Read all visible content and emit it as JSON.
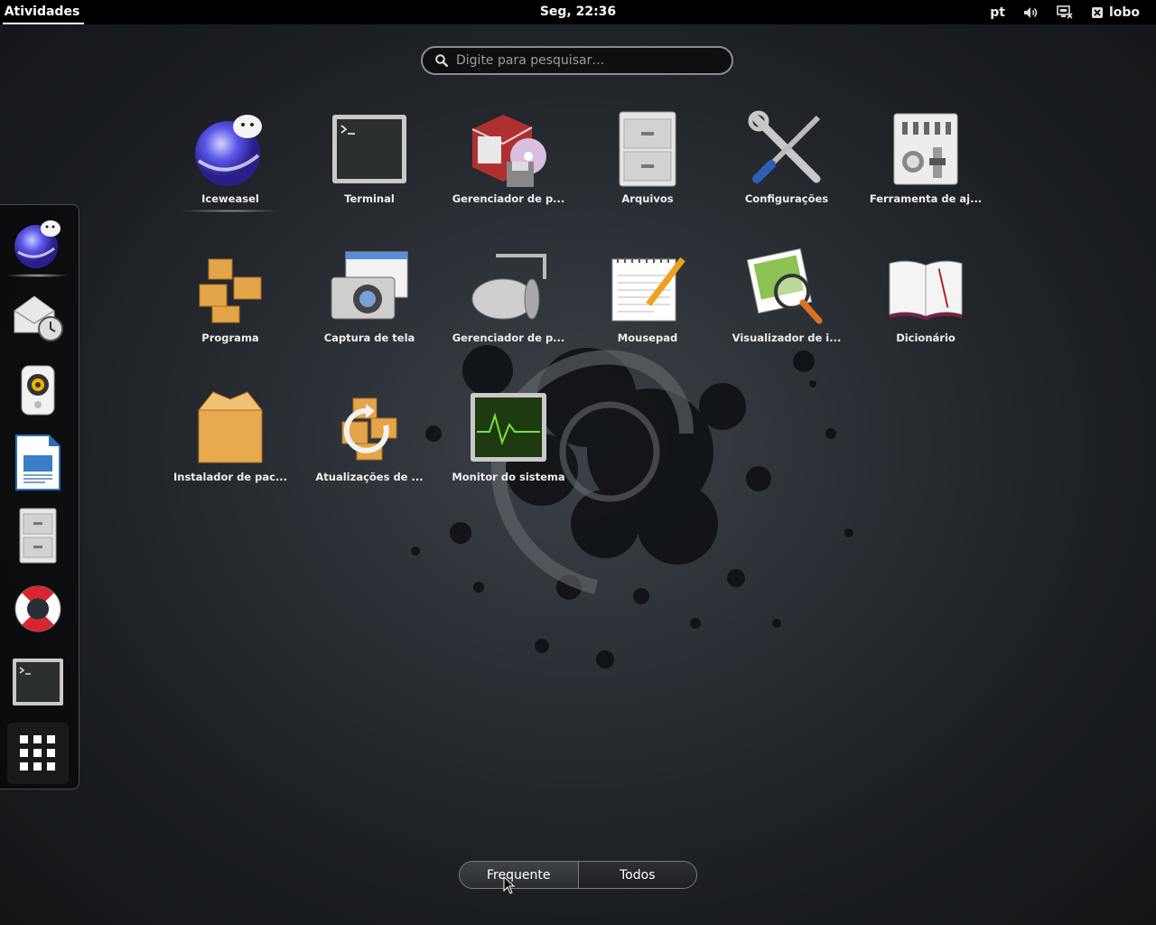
{
  "topbar": {
    "activities": "Atividades",
    "clock": "Seg, 22:36",
    "lang": "pt",
    "user": "lobo"
  },
  "search": {
    "placeholder": "Digite para pesquisar…"
  },
  "dash": {
    "items": [
      "iceweasel-icon",
      "mail-clock-icon",
      "speaker-icon",
      "writer-document-icon",
      "file-cabinet-icon",
      "lifebuoy-icon",
      "terminal-icon",
      "apps-grid-icon"
    ]
  },
  "apps": [
    {
      "label": "Iceweasel",
      "icon": "iceweasel-icon"
    },
    {
      "label": "Terminal",
      "icon": "terminal-icon"
    },
    {
      "label": "Gerenciador de p...",
      "icon": "package-manager-icon"
    },
    {
      "label": "Arquivos",
      "icon": "file-cabinet-icon"
    },
    {
      "label": "Configurações",
      "icon": "tools-icon"
    },
    {
      "label": "Ferramenta de aj...",
      "icon": "mixer-icon"
    },
    {
      "label": "Programa",
      "icon": "boxes-icon"
    },
    {
      "label": "Captura de tela",
      "icon": "camera-icon"
    },
    {
      "label": "Gerenciador de p...",
      "icon": "roller-icon"
    },
    {
      "label": "Mousepad",
      "icon": "notepad-icon"
    },
    {
      "label": "Visualizador de i...",
      "icon": "image-viewer-icon"
    },
    {
      "label": "Dicionário",
      "icon": "book-icon"
    },
    {
      "label": "Instalador de pac...",
      "icon": "box-icon"
    },
    {
      "label": "Atualizações de ...",
      "icon": "update-icon"
    },
    {
      "label": "Monitor do sistema",
      "icon": "system-monitor-icon"
    }
  ],
  "view_toggle": {
    "frequent": "Frequente",
    "all": "Todos",
    "selected": "Frequente"
  }
}
